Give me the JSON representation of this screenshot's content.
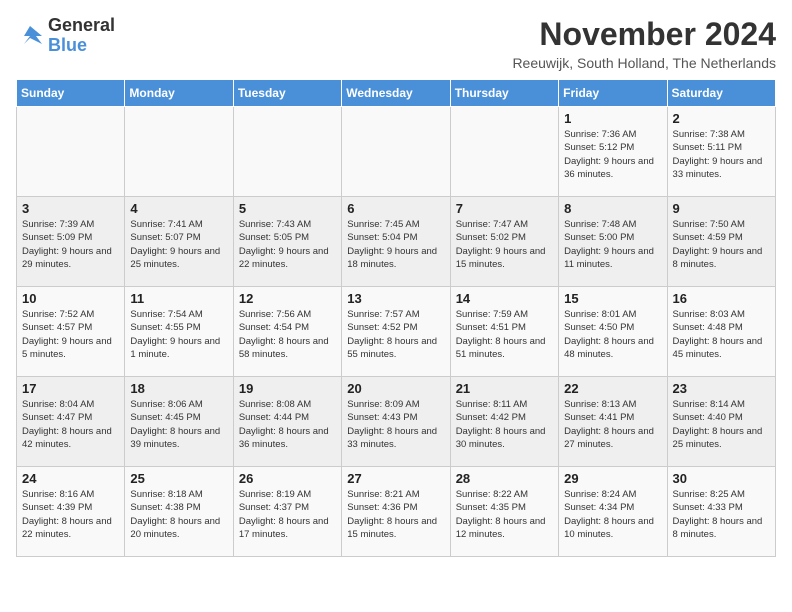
{
  "logo": {
    "general": "General",
    "blue": "Blue"
  },
  "header": {
    "title": "November 2024",
    "subtitle": "Reeuwijk, South Holland, The Netherlands"
  },
  "weekdays": [
    "Sunday",
    "Monday",
    "Tuesday",
    "Wednesday",
    "Thursday",
    "Friday",
    "Saturday"
  ],
  "weeks": [
    [
      {
        "day": "",
        "info": ""
      },
      {
        "day": "",
        "info": ""
      },
      {
        "day": "",
        "info": ""
      },
      {
        "day": "",
        "info": ""
      },
      {
        "day": "",
        "info": ""
      },
      {
        "day": "1",
        "info": "Sunrise: 7:36 AM\nSunset: 5:12 PM\nDaylight: 9 hours and 36 minutes."
      },
      {
        "day": "2",
        "info": "Sunrise: 7:38 AM\nSunset: 5:11 PM\nDaylight: 9 hours and 33 minutes."
      }
    ],
    [
      {
        "day": "3",
        "info": "Sunrise: 7:39 AM\nSunset: 5:09 PM\nDaylight: 9 hours and 29 minutes."
      },
      {
        "day": "4",
        "info": "Sunrise: 7:41 AM\nSunset: 5:07 PM\nDaylight: 9 hours and 25 minutes."
      },
      {
        "day": "5",
        "info": "Sunrise: 7:43 AM\nSunset: 5:05 PM\nDaylight: 9 hours and 22 minutes."
      },
      {
        "day": "6",
        "info": "Sunrise: 7:45 AM\nSunset: 5:04 PM\nDaylight: 9 hours and 18 minutes."
      },
      {
        "day": "7",
        "info": "Sunrise: 7:47 AM\nSunset: 5:02 PM\nDaylight: 9 hours and 15 minutes."
      },
      {
        "day": "8",
        "info": "Sunrise: 7:48 AM\nSunset: 5:00 PM\nDaylight: 9 hours and 11 minutes."
      },
      {
        "day": "9",
        "info": "Sunrise: 7:50 AM\nSunset: 4:59 PM\nDaylight: 9 hours and 8 minutes."
      }
    ],
    [
      {
        "day": "10",
        "info": "Sunrise: 7:52 AM\nSunset: 4:57 PM\nDaylight: 9 hours and 5 minutes."
      },
      {
        "day": "11",
        "info": "Sunrise: 7:54 AM\nSunset: 4:55 PM\nDaylight: 9 hours and 1 minute."
      },
      {
        "day": "12",
        "info": "Sunrise: 7:56 AM\nSunset: 4:54 PM\nDaylight: 8 hours and 58 minutes."
      },
      {
        "day": "13",
        "info": "Sunrise: 7:57 AM\nSunset: 4:52 PM\nDaylight: 8 hours and 55 minutes."
      },
      {
        "day": "14",
        "info": "Sunrise: 7:59 AM\nSunset: 4:51 PM\nDaylight: 8 hours and 51 minutes."
      },
      {
        "day": "15",
        "info": "Sunrise: 8:01 AM\nSunset: 4:50 PM\nDaylight: 8 hours and 48 minutes."
      },
      {
        "day": "16",
        "info": "Sunrise: 8:03 AM\nSunset: 4:48 PM\nDaylight: 8 hours and 45 minutes."
      }
    ],
    [
      {
        "day": "17",
        "info": "Sunrise: 8:04 AM\nSunset: 4:47 PM\nDaylight: 8 hours and 42 minutes."
      },
      {
        "day": "18",
        "info": "Sunrise: 8:06 AM\nSunset: 4:45 PM\nDaylight: 8 hours and 39 minutes."
      },
      {
        "day": "19",
        "info": "Sunrise: 8:08 AM\nSunset: 4:44 PM\nDaylight: 8 hours and 36 minutes."
      },
      {
        "day": "20",
        "info": "Sunrise: 8:09 AM\nSunset: 4:43 PM\nDaylight: 8 hours and 33 minutes."
      },
      {
        "day": "21",
        "info": "Sunrise: 8:11 AM\nSunset: 4:42 PM\nDaylight: 8 hours and 30 minutes."
      },
      {
        "day": "22",
        "info": "Sunrise: 8:13 AM\nSunset: 4:41 PM\nDaylight: 8 hours and 27 minutes."
      },
      {
        "day": "23",
        "info": "Sunrise: 8:14 AM\nSunset: 4:40 PM\nDaylight: 8 hours and 25 minutes."
      }
    ],
    [
      {
        "day": "24",
        "info": "Sunrise: 8:16 AM\nSunset: 4:39 PM\nDaylight: 8 hours and 22 minutes."
      },
      {
        "day": "25",
        "info": "Sunrise: 8:18 AM\nSunset: 4:38 PM\nDaylight: 8 hours and 20 minutes."
      },
      {
        "day": "26",
        "info": "Sunrise: 8:19 AM\nSunset: 4:37 PM\nDaylight: 8 hours and 17 minutes."
      },
      {
        "day": "27",
        "info": "Sunrise: 8:21 AM\nSunset: 4:36 PM\nDaylight: 8 hours and 15 minutes."
      },
      {
        "day": "28",
        "info": "Sunrise: 8:22 AM\nSunset: 4:35 PM\nDaylight: 8 hours and 12 minutes."
      },
      {
        "day": "29",
        "info": "Sunrise: 8:24 AM\nSunset: 4:34 PM\nDaylight: 8 hours and 10 minutes."
      },
      {
        "day": "30",
        "info": "Sunrise: 8:25 AM\nSunset: 4:33 PM\nDaylight: 8 hours and 8 minutes."
      }
    ]
  ]
}
